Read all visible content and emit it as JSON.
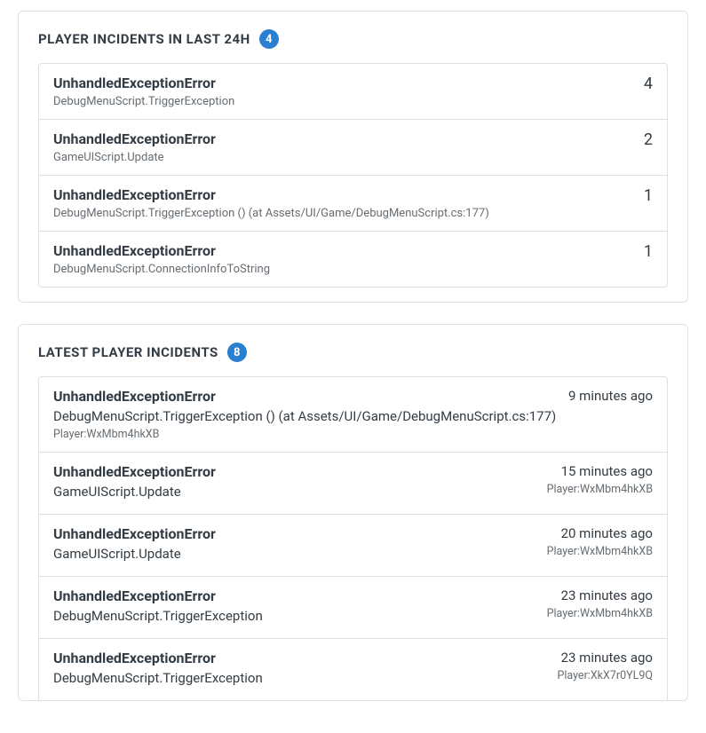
{
  "panel24h": {
    "title": "PLAYER INCIDENTS IN LAST 24H",
    "badge": "4",
    "items": [
      {
        "title": "UnhandledExceptionError",
        "detail": "DebugMenuScript.TriggerException",
        "count": "4"
      },
      {
        "title": "UnhandledExceptionError",
        "detail": "GameUIScript.Update",
        "count": "2"
      },
      {
        "title": "UnhandledExceptionError",
        "detail": "DebugMenuScript.TriggerException () (at Assets/UI/Game/DebugMenuScript.cs:177)",
        "count": "1"
      },
      {
        "title": "UnhandledExceptionError",
        "detail": "DebugMenuScript.ConnectionInfoToString",
        "count": "1"
      }
    ]
  },
  "panelLatest": {
    "title": "LATEST PLAYER INCIDENTS",
    "badge": "8",
    "items": [
      {
        "title": "UnhandledExceptionError",
        "detail": "DebugMenuScript.TriggerException () (at Assets/UI/Game/DebugMenuScript.cs:177)",
        "time": "9 minutes ago",
        "player": "Player:WxMbm4hkXB"
      },
      {
        "title": "UnhandledExceptionError",
        "detail": "GameUIScript.Update",
        "time": "15 minutes ago",
        "player": "Player:WxMbm4hkXB"
      },
      {
        "title": "UnhandledExceptionError",
        "detail": "GameUIScript.Update",
        "time": "20 minutes ago",
        "player": "Player:WxMbm4hkXB"
      },
      {
        "title": "UnhandledExceptionError",
        "detail": "DebugMenuScript.TriggerException",
        "time": "23 minutes ago",
        "player": "Player:WxMbm4hkXB"
      },
      {
        "title": "UnhandledExceptionError",
        "detail": "DebugMenuScript.TriggerException",
        "time": "23 minutes ago",
        "player": "Player:XkX7r0YL9Q"
      }
    ]
  }
}
